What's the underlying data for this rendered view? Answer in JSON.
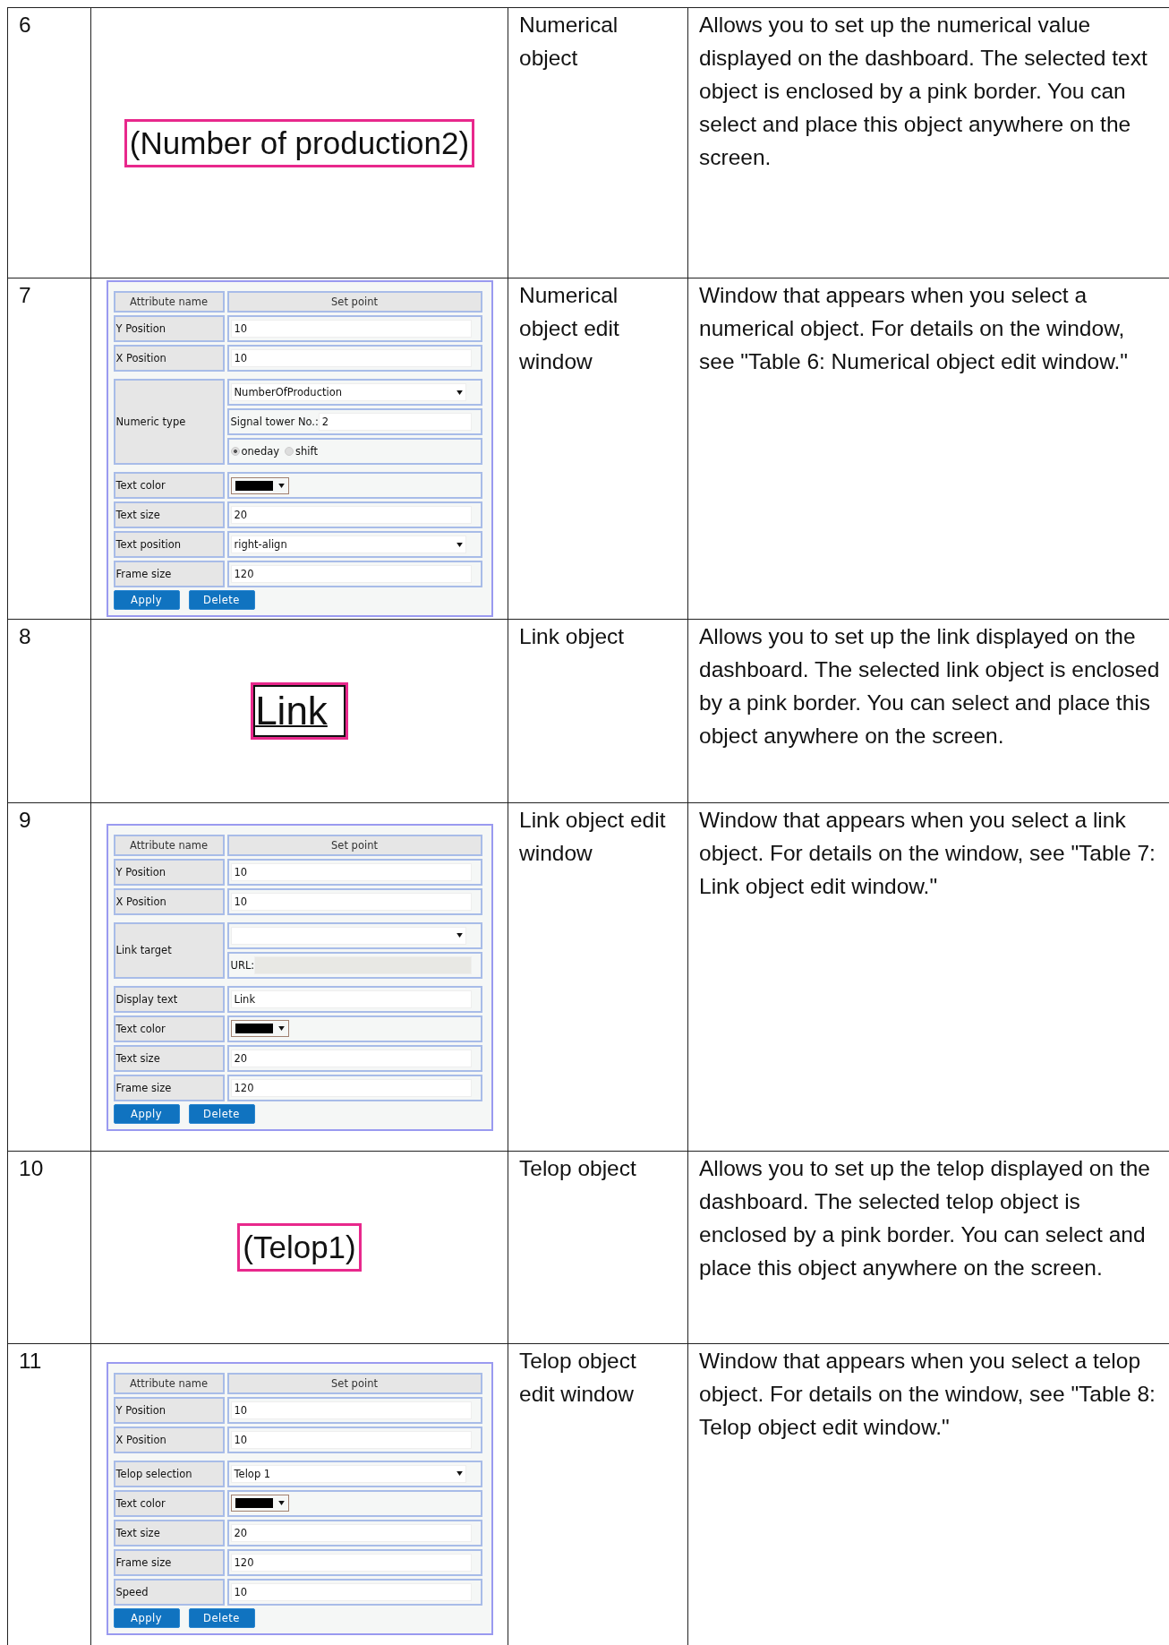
{
  "rows": [
    {
      "number": "6",
      "kind": "preview",
      "preview": {
        "kind": "framed",
        "text": "(Number of production2)"
      },
      "name": "Numerical object",
      "description": "Allows you to set up the numerical value displayed on the dashboard. The selected text object is enclosed by a pink border. You can select and place this object anywhere on the screen."
    },
    {
      "number": "7",
      "kind": "window",
      "window": {
        "header": [
          "Attribute name",
          "Set point"
        ],
        "attributes": [
          {
            "label": "Y Position",
            "controls": [
              {
                "kind": "text",
                "value": "10"
              }
            ]
          },
          {
            "label": "X Position",
            "controls": [
              {
                "kind": "text",
                "value": "10"
              }
            ]
          },
          {
            "label": "Numeric type",
            "controls": [
              {
                "kind": "select",
                "value": "NumberOfProduction"
              },
              {
                "kind": "labeled",
                "label": "Signal tower No.:",
                "value": "2",
                "disabled": false
              },
              {
                "kind": "radio",
                "options": [
                  {
                    "label": "oneday",
                    "selected": true
                  },
                  {
                    "label": "shift",
                    "selected": false
                  }
                ]
              }
            ]
          },
          {
            "label": "Text color",
            "controls": [
              {
                "kind": "color"
              }
            ]
          },
          {
            "label": "Text size",
            "controls": [
              {
                "kind": "text",
                "value": "20"
              }
            ]
          },
          {
            "label": "Text position",
            "controls": [
              {
                "kind": "select",
                "value": "right-align"
              }
            ]
          },
          {
            "label": "Frame size",
            "controls": [
              {
                "kind": "text",
                "value": "120"
              }
            ]
          }
        ],
        "buttons": [
          "Apply",
          "Delete"
        ]
      },
      "name": "Numerical object edit window",
      "description": "Window that appears when you select a numerical object. For details on the window, see \"Table 6: Numerical object edit window.\""
    },
    {
      "number": "8",
      "kind": "preview",
      "preview": {
        "kind": "link",
        "text": "Link"
      },
      "name": "Link object",
      "description": "Allows you to set up the link displayed on the dashboard. The selected link object is enclosed by a pink border. You can select and place this object anywhere on the screen."
    },
    {
      "number": "9",
      "kind": "window",
      "window": {
        "header": [
          "Attribute name",
          "Set point"
        ],
        "attributes": [
          {
            "label": "Y Position",
            "controls": [
              {
                "kind": "text",
                "value": "10"
              }
            ]
          },
          {
            "label": "X Position",
            "controls": [
              {
                "kind": "text",
                "value": "10"
              }
            ]
          },
          {
            "label": "Link target",
            "controls": [
              {
                "kind": "select"
              },
              {
                "kind": "labeled",
                "label": "URL:",
                "disabled": true
              }
            ]
          },
          {
            "label": "Display text",
            "controls": [
              {
                "kind": "text",
                "value": "Link"
              }
            ]
          },
          {
            "label": "Text color",
            "controls": [
              {
                "kind": "color"
              }
            ]
          },
          {
            "label": "Text size",
            "controls": [
              {
                "kind": "text",
                "value": "20"
              }
            ]
          },
          {
            "label": "Frame size",
            "controls": [
              {
                "kind": "text",
                "value": "120"
              }
            ]
          }
        ],
        "buttons": [
          "Apply",
          "Delete"
        ]
      },
      "name": "Link object edit window",
      "description": "Window that appears when you select a link object. For details on the window, see \"Table 7: Link object edit window.\""
    },
    {
      "number": "10",
      "kind": "preview",
      "preview": {
        "kind": "framed",
        "text": "(Telop1)"
      },
      "name": "Telop object",
      "description": "Allows you to set up the telop displayed on the dashboard. The selected telop object is enclosed by a pink border. You can select and place this object anywhere on the screen."
    },
    {
      "number": "11",
      "kind": "window",
      "window": {
        "header": [
          "Attribute name",
          "Set point"
        ],
        "attributes": [
          {
            "label": "Y Position",
            "controls": [
              {
                "kind": "text",
                "value": "10"
              }
            ]
          },
          {
            "label": "X Position",
            "controls": [
              {
                "kind": "text",
                "value": "10"
              }
            ]
          },
          {
            "label": "Telop selection",
            "controls": [
              {
                "kind": "select",
                "value": "Telop 1"
              }
            ]
          },
          {
            "label": "Text color",
            "controls": [
              {
                "kind": "color"
              }
            ]
          },
          {
            "label": "Text size",
            "controls": [
              {
                "kind": "text",
                "value": "20"
              }
            ]
          },
          {
            "label": "Frame size",
            "controls": [
              {
                "kind": "text",
                "value": "120"
              }
            ]
          },
          {
            "label": "Speed",
            "controls": [
              {
                "kind": "text",
                "value": "10"
              }
            ]
          }
        ],
        "buttons": [
          "Apply",
          "Delete"
        ]
      },
      "name": "Telop object edit window",
      "description": "Window that appears when you select a telop object. For details on the window, see \"Table 8: Telop object edit window.\""
    }
  ]
}
